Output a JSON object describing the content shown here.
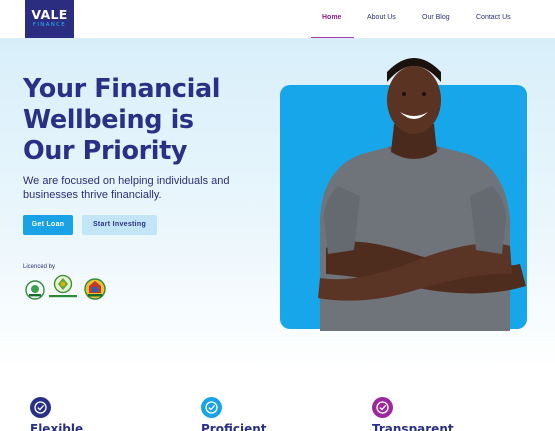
{
  "header": {
    "logo_main": "VALE",
    "logo_sub": "FINANCE",
    "nav": [
      {
        "label": "Home",
        "active": true
      },
      {
        "label": "About Us",
        "active": false
      },
      {
        "label": "Our Blog",
        "active": false
      },
      {
        "label": "Contact Us",
        "active": false
      }
    ]
  },
  "hero": {
    "title_lines": [
      "Your Financial",
      "Wellbeing is",
      "Our Priority"
    ],
    "subtitle": "We are focused on helping individuals and businesses thrive financially.",
    "primary_button": "Get Loan",
    "secondary_button": "Start Investing",
    "licenced_label": "Licenced by",
    "licensors": [
      {
        "name": "PENCOM",
        "icon": "pencom-seal-icon"
      },
      {
        "name": "Central Bank of Nigeria",
        "icon": "cbn-seal-icon"
      },
      {
        "name": "Lagos State",
        "icon": "lagos-seal-icon"
      }
    ]
  },
  "features": [
    {
      "title": "Flexible",
      "icon": "check-circle-icon",
      "color": "#2b2f85"
    },
    {
      "title": "Proficient",
      "icon": "check-circle-icon",
      "color": "#19a3e6"
    },
    {
      "title": "Transparent",
      "icon": "check-circle-icon",
      "color": "#9c2a9e"
    }
  ],
  "colors": {
    "brand_navy": "#2b2d80",
    "brand_blue": "#19a3e6",
    "accent_purple": "#a53aa8"
  }
}
